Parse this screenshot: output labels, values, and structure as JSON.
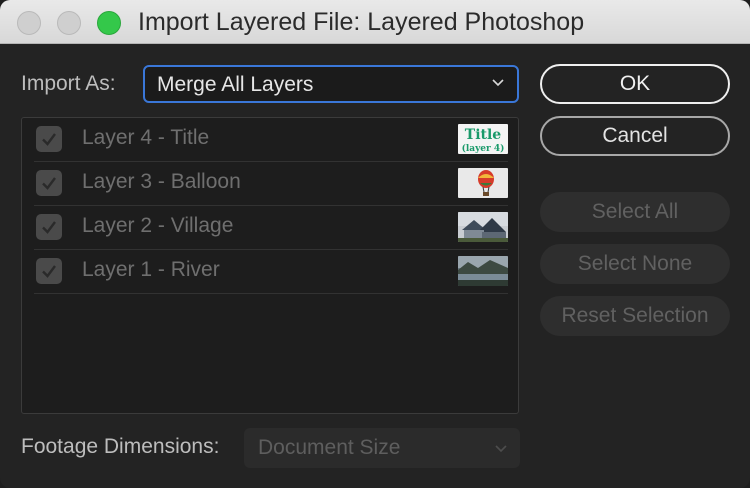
{
  "window": {
    "title": "Import Layered File: Layered Photoshop"
  },
  "import_as": {
    "label": "Import As:",
    "selected": "Merge All Layers"
  },
  "layers": [
    {
      "name": "Layer 4 - Title",
      "checked": true,
      "thumb_text_1": "Title",
      "thumb_text_2": "(layer 4)"
    },
    {
      "name": "Layer 3 - Balloon",
      "checked": true
    },
    {
      "name": "Layer 2 - Village",
      "checked": true
    },
    {
      "name": "Layer 1 - River",
      "checked": true
    }
  ],
  "buttons": {
    "ok": "OK",
    "cancel": "Cancel",
    "select_all": "Select All",
    "select_none": "Select None",
    "reset_selection": "Reset Selection"
  },
  "footage_dimensions": {
    "label": "Footage Dimensions:",
    "selected": "Document Size"
  },
  "colors": {
    "accent": "#3a77d8",
    "zoom_button": "#34c84a"
  }
}
